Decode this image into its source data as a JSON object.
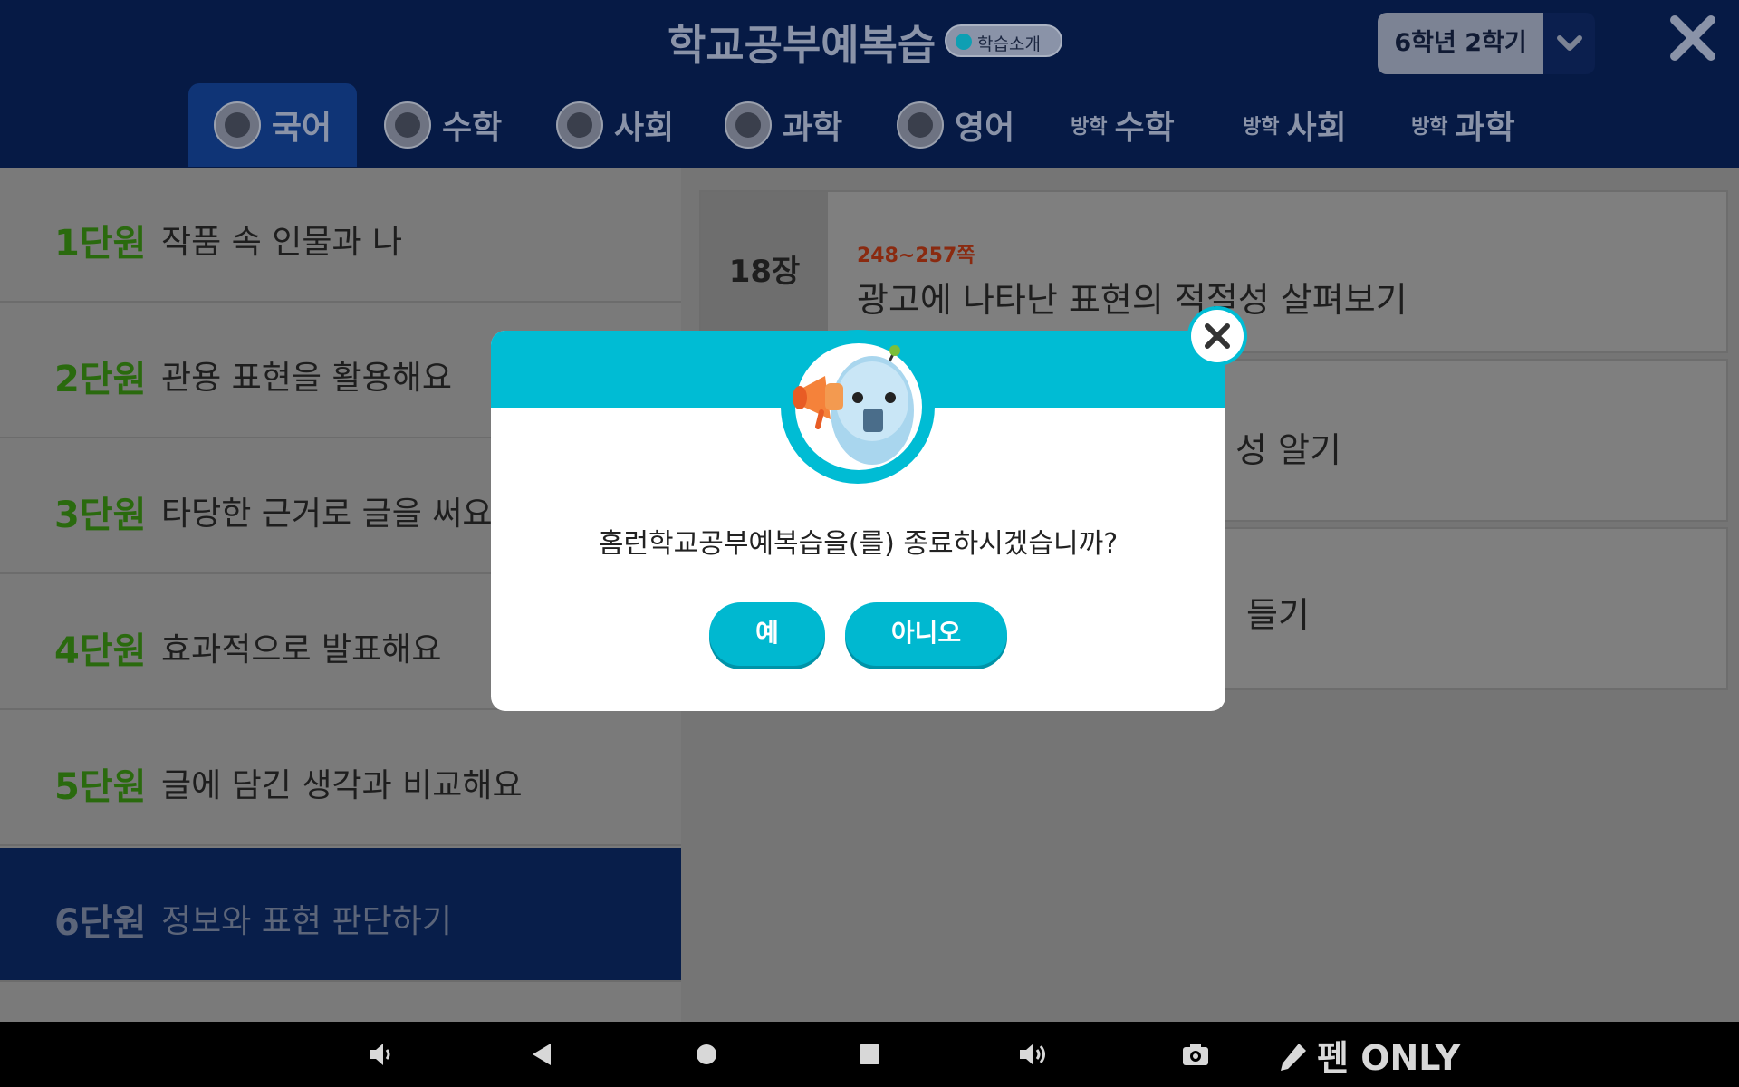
{
  "header": {
    "title": "학교공부예복습",
    "intro_badge": "학습소개",
    "grade_selector": {
      "value": "6학년 2학기",
      "icon": "chevron-down-icon"
    },
    "close_icon": "close-icon"
  },
  "subject_tabs": [
    {
      "prefix": "",
      "label": "국어",
      "active": true
    },
    {
      "prefix": "",
      "label": "수학"
    },
    {
      "prefix": "",
      "label": "사회"
    },
    {
      "prefix": "",
      "label": "과학"
    },
    {
      "prefix": "",
      "label": "영어"
    },
    {
      "prefix": "방학",
      "label": "수학"
    },
    {
      "prefix": "방학",
      "label": "사회"
    },
    {
      "prefix": "방학",
      "label": "과학"
    }
  ],
  "units": [
    {
      "number": "1단원",
      "title": "작품 속 인물과 나"
    },
    {
      "number": "2단원",
      "title": "관용 표현을 활용해요"
    },
    {
      "number": "3단원",
      "title": "타당한 근거로 글을 써요"
    },
    {
      "number": "4단원",
      "title": "효과적으로 발표해요"
    },
    {
      "number": "5단원",
      "title": "글에 담긴 생각과 비교해요"
    },
    {
      "number": "6단원",
      "title": "정보와 표현 판단하기",
      "active": true
    }
  ],
  "chapters": [
    {
      "number": "18장",
      "pages": "248~257쪽",
      "title": "광고에 나타난 표현의 적절성 살펴보기"
    },
    {
      "number": "",
      "pages": "",
      "title": "성 알기"
    },
    {
      "number": "",
      "pages": "",
      "title": "들기"
    }
  ],
  "dialog": {
    "message": "홈런학교공부예복습을(를) 종료하시겠습니까?",
    "yes_label": "예",
    "no_label": "아니오",
    "accent_color": "#00bcd4"
  },
  "navbar": {
    "pen_only_label": "펜 ONLY"
  }
}
